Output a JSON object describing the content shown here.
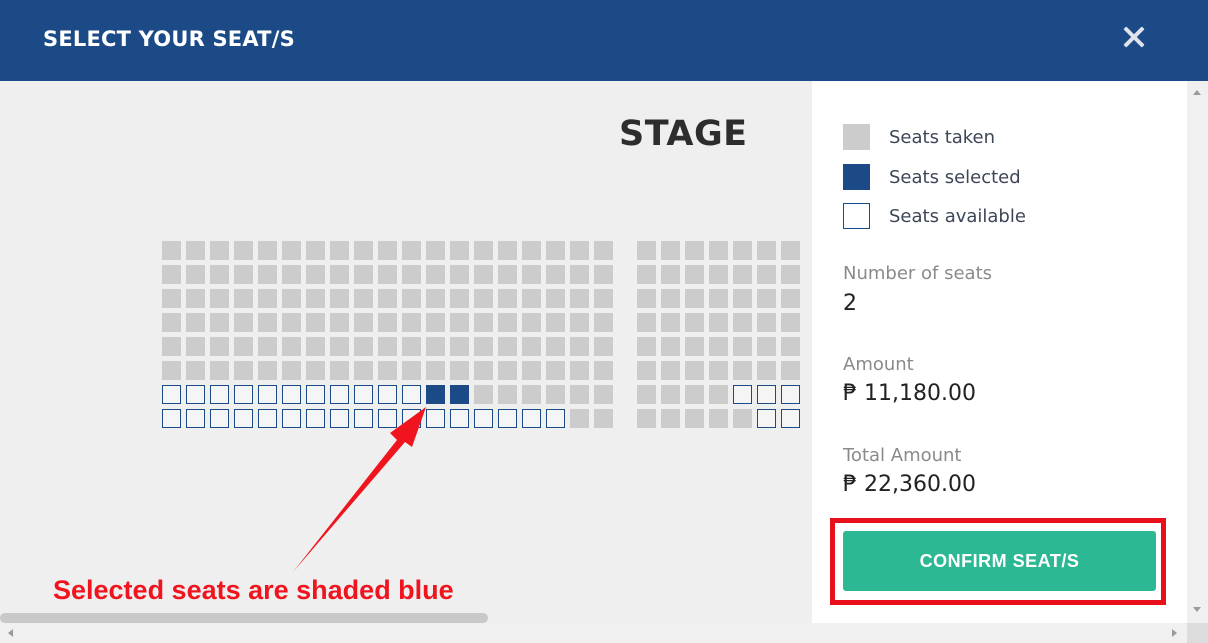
{
  "header": {
    "title": "SELECT YOUR SEAT/S",
    "close_icon": "close-icon"
  },
  "seat_map": {
    "stage_label": "STAGE",
    "legend_states": {
      "T": "taken",
      "S": "selected",
      "A": "available"
    },
    "left_block": {
      "rows": [
        "TTTTTTTTTTTTTTTTTTT",
        "TTTTTTTTTTTTTTTTTTT",
        "TTTTTTTTTTTTTTTTTTT",
        "TTTTTTTTTTTTTTTTTTT",
        "TTTTTTTTTTTTTTTTTTT",
        "TTTTTTTTTTTTTTTTTTT",
        "AAAAAAAAAAASSTTTTTT",
        "AAAAAAAAAAAAAAAAATT"
      ]
    },
    "right_block": {
      "rows": [
        "TTTTTTT",
        "TTTTTTT",
        "TTTTTTT",
        "TTTTTTT",
        "TTTTTTT",
        "TTTTTTT",
        "TTTTAAA",
        "TTTTTAA"
      ]
    }
  },
  "legend": [
    {
      "state": "taken",
      "label": "Seats taken"
    },
    {
      "state": "selected",
      "label": "Seats selected"
    },
    {
      "state": "available",
      "label": "Seats available"
    }
  ],
  "summary": {
    "seats_label": "Number of seats",
    "seats_value": "2",
    "amount_label": "Amount",
    "amount_value": "₱ 11,180.00",
    "total_label": "Total Amount",
    "total_value": "₱ 22,360.00"
  },
  "confirm_button": {
    "label": "CONFIRM SEAT/S"
  },
  "annotation": {
    "text": "Selected seats are shaded blue",
    "color": "#f0141e"
  },
  "colors": {
    "brand": "#1c4a87",
    "taken": "#cccccc",
    "confirm": "#2db894",
    "highlight": "#e8101a"
  }
}
